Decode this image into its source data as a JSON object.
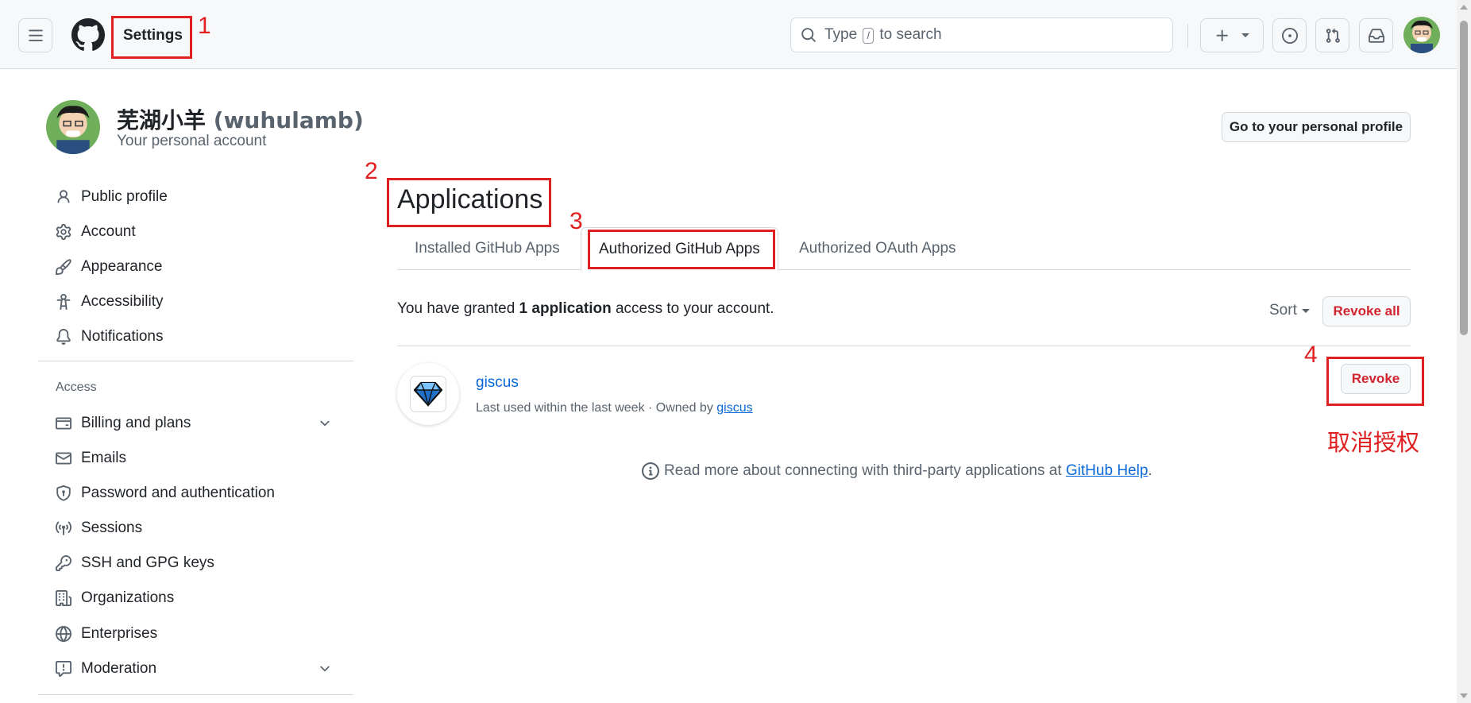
{
  "header": {
    "title": "Settings",
    "search": {
      "prefix": "Type",
      "key": "/",
      "suffix": "to search"
    },
    "icons": [
      "hamburger-icon",
      "github-logo-icon",
      "search-icon",
      "plus-icon",
      "issue-icon",
      "pull-request-icon",
      "inbox-icon"
    ]
  },
  "profile": {
    "display_name": "芜湖小羊",
    "login": "(wuhulamb)",
    "subtitle": "Your personal account",
    "go_profile_label": "Go to your personal profile"
  },
  "sidebar": {
    "items": [
      {
        "label": "Public profile",
        "icon": "person-icon"
      },
      {
        "label": "Account",
        "icon": "gear-icon"
      },
      {
        "label": "Appearance",
        "icon": "paintbrush-icon"
      },
      {
        "label": "Accessibility",
        "icon": "accessibility-icon"
      },
      {
        "label": "Notifications",
        "icon": "bell-icon"
      }
    ],
    "access_heading": "Access",
    "access_items": [
      {
        "label": "Billing and plans",
        "icon": "credit-card-icon"
      },
      {
        "label": "Emails",
        "icon": "mail-icon"
      },
      {
        "label": "Password and authentication",
        "icon": "shield-icon"
      },
      {
        "label": "Sessions",
        "icon": "broadcast-icon"
      },
      {
        "label": "SSH and GPG keys",
        "icon": "key-icon"
      },
      {
        "label": "Organizations",
        "icon": "organization-icon"
      },
      {
        "label": "Enterprises",
        "icon": "globe-icon"
      },
      {
        "label": "Moderation",
        "icon": "report-icon"
      }
    ]
  },
  "main": {
    "title": "Applications",
    "tabs": [
      {
        "label": "Installed GitHub Apps"
      },
      {
        "label": "Authorized GitHub Apps",
        "selected": true
      },
      {
        "label": "Authorized OAuth Apps"
      }
    ],
    "granted": {
      "prefix": "You have granted",
      "count": "1 application",
      "suffix": "access to your account."
    },
    "sort_label": "Sort",
    "revoke_all_label": "Revoke all",
    "apps": [
      {
        "name": "giscus",
        "meta_prefix": "Last used within the last week · Owned by",
        "owner": "giscus",
        "revoke_label": "Revoke"
      }
    ],
    "help": {
      "text": "Read more about connecting with third-party applications at",
      "link": "GitHub Help",
      "end": "."
    }
  },
  "annotations": {
    "numbers": [
      "1",
      "2",
      "3",
      "4"
    ],
    "revoke_note": "取消授权",
    "color": "#e02020"
  },
  "colors": {
    "link": "#0969da",
    "danger": "#d1242f",
    "header_bg": "#f6f8fa",
    "border": "#d1d9e0"
  }
}
